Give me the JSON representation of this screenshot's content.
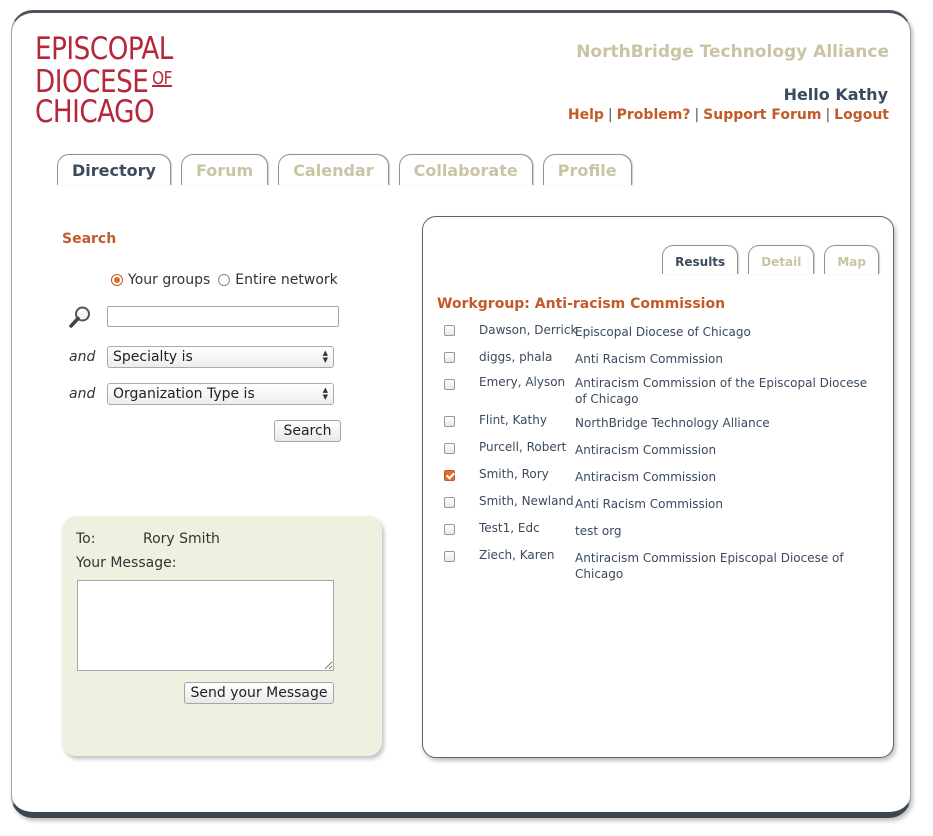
{
  "header": {
    "logo_line1": "EPISCOPAL",
    "logo_line2": "DIOCESE",
    "logo_of": "OF",
    "logo_line3": "CHICAGO",
    "org_name": "NorthBridge Technology Alliance",
    "greeting": "Hello Kathy",
    "links": [
      "Help",
      "Problem?",
      "Support Forum",
      "Logout"
    ],
    "separator": "|"
  },
  "nav": {
    "tabs": [
      "Directory",
      "Forum",
      "Calendar",
      "Collaborate",
      "Profile"
    ],
    "active": "Directory"
  },
  "search": {
    "title": "Search",
    "scope_options": [
      "Your groups",
      "Entire network"
    ],
    "scope_selected": "Your groups",
    "query_value": "",
    "and_label": "and",
    "filter1": "Specialty is",
    "filter2": "Organization Type is",
    "button": "Search"
  },
  "message": {
    "to_label": "To:",
    "to_name": "Rory Smith",
    "message_label": "Your Message:",
    "message_value": "",
    "send_button": "Send your Message"
  },
  "results": {
    "tabs": [
      "Results",
      "Detail",
      "Map"
    ],
    "active_tab": "Results",
    "workgroup_title": "Workgroup: Anti-racism Commission",
    "rows": [
      {
        "name": "Dawson, Derrick",
        "org": "Episcopal Diocese of Chicago",
        "checked": false
      },
      {
        "name": "diggs, phala",
        "org": "Anti Racism Commission",
        "checked": false
      },
      {
        "name": "Emery, Alyson",
        "org": "Antiracism Commission of the Episcopal Diocese of Chicago",
        "checked": false
      },
      {
        "name": "Flint, Kathy",
        "org": "NorthBridge Technology Alliance",
        "checked": false
      },
      {
        "name": "Purcell, Robert",
        "org": "Antiracism Commission",
        "checked": false
      },
      {
        "name": "Smith, Rory",
        "org": "Antiracism Commission",
        "checked": true
      },
      {
        "name": "Smith, Newland",
        "org": "Anti Racism Commission",
        "checked": false
      },
      {
        "name": "Test1, Edc",
        "org": "test org",
        "checked": false
      },
      {
        "name": "Ziech, Karen",
        "org": "Antiracism Commission Episcopal Diocese of Chicago",
        "checked": false
      }
    ]
  },
  "colors": {
    "brand_red": "#b5283a",
    "accent_orange": "#c45a28",
    "navy": "#3b4a5e",
    "muted_tab": "#c8c4a4",
    "message_bg": "#f0f0e0"
  }
}
